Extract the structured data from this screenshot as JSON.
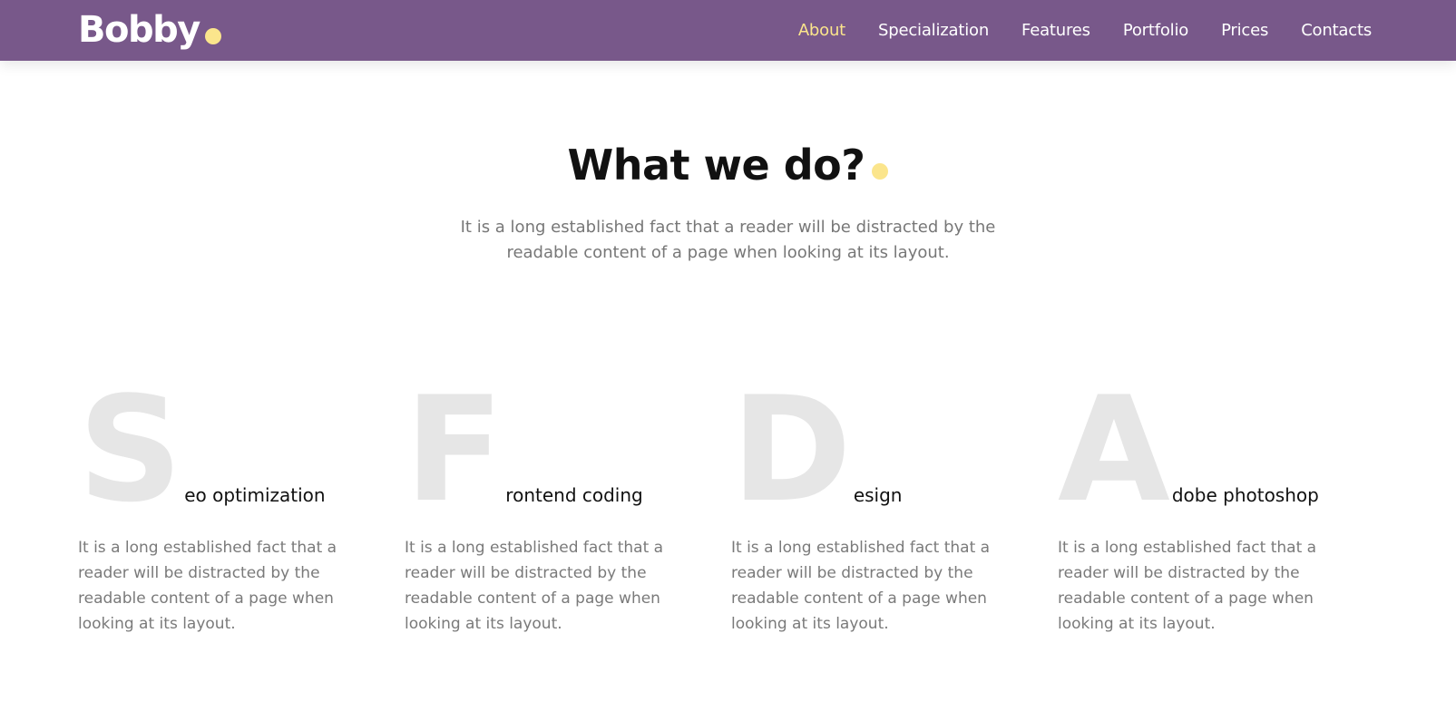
{
  "colors": {
    "header_bg": "#78588a",
    "accent_yellow": "#fbe58c",
    "heading": "#111111",
    "body_text": "#777777",
    "big_letter": "#e6e6e6"
  },
  "header": {
    "logo": "Bobby",
    "nav": [
      {
        "label": "About",
        "active": true
      },
      {
        "label": "Specialization",
        "active": false
      },
      {
        "label": "Features",
        "active": false
      },
      {
        "label": "Portfolio",
        "active": false
      },
      {
        "label": "Prices",
        "active": false
      },
      {
        "label": "Contacts",
        "active": false
      }
    ]
  },
  "intro": {
    "title": "What we do?",
    "text": "It is a long established fact that a reader will be distracted by the readable content of a page when looking at its layout."
  },
  "features": [
    {
      "letter": "S",
      "title": "eo optimization",
      "text": "It is a long established fact that a reader will be distracted by the readable content of a page when looking at its layout."
    },
    {
      "letter": "F",
      "title": "rontend coding",
      "text": "It is a long established fact that a reader will be distracted by the readable content of a page when looking at its layout."
    },
    {
      "letter": "D",
      "title": "esign",
      "text": "It is a long established fact that a reader will be distracted by the readable content of a page when looking at its layout."
    },
    {
      "letter": "A",
      "title": "dobe photoshop",
      "text": "It is a long established fact that a reader will be distracted by the readable content of a page when looking at its layout."
    }
  ]
}
